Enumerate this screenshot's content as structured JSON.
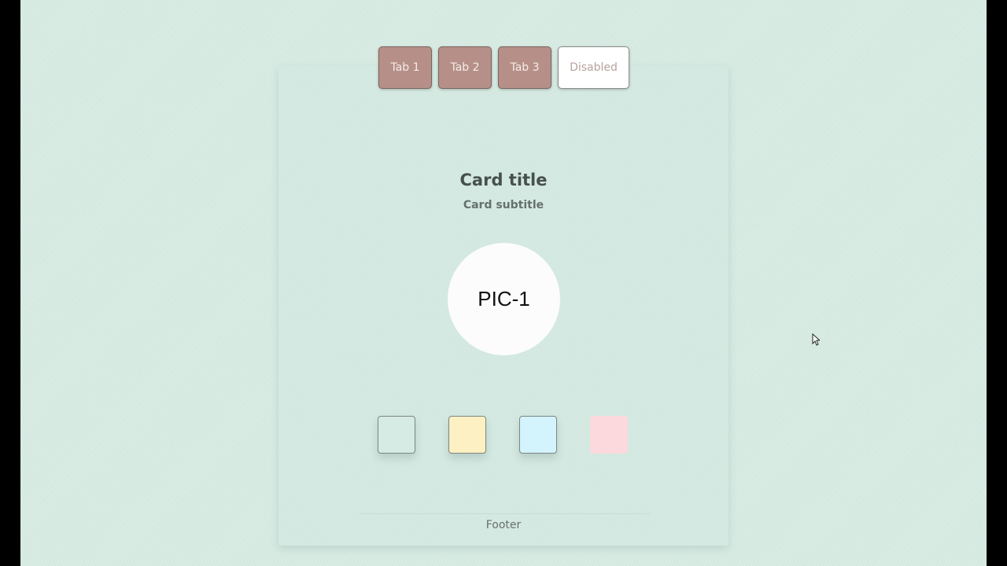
{
  "tabs": [
    {
      "label": "Tab 1",
      "state": "normal"
    },
    {
      "label": "Tab 2",
      "state": "normal"
    },
    {
      "label": "Tab 3",
      "state": "normal"
    },
    {
      "label": "Disabled",
      "state": "disabled"
    }
  ],
  "card": {
    "title": "Card title",
    "subtitle": "Card subtitle",
    "image_label": "PIC-1",
    "footer": "Footer"
  },
  "swatches": [
    {
      "color": "#d5ebe3"
    },
    {
      "color": "#fdf0c3"
    },
    {
      "color": "#d3f3fd"
    },
    {
      "color": "#fbd9dd"
    }
  ],
  "colors": {
    "background": "#d7ebe3",
    "tab": "#b69088",
    "tab_text": "#f5ecea"
  }
}
